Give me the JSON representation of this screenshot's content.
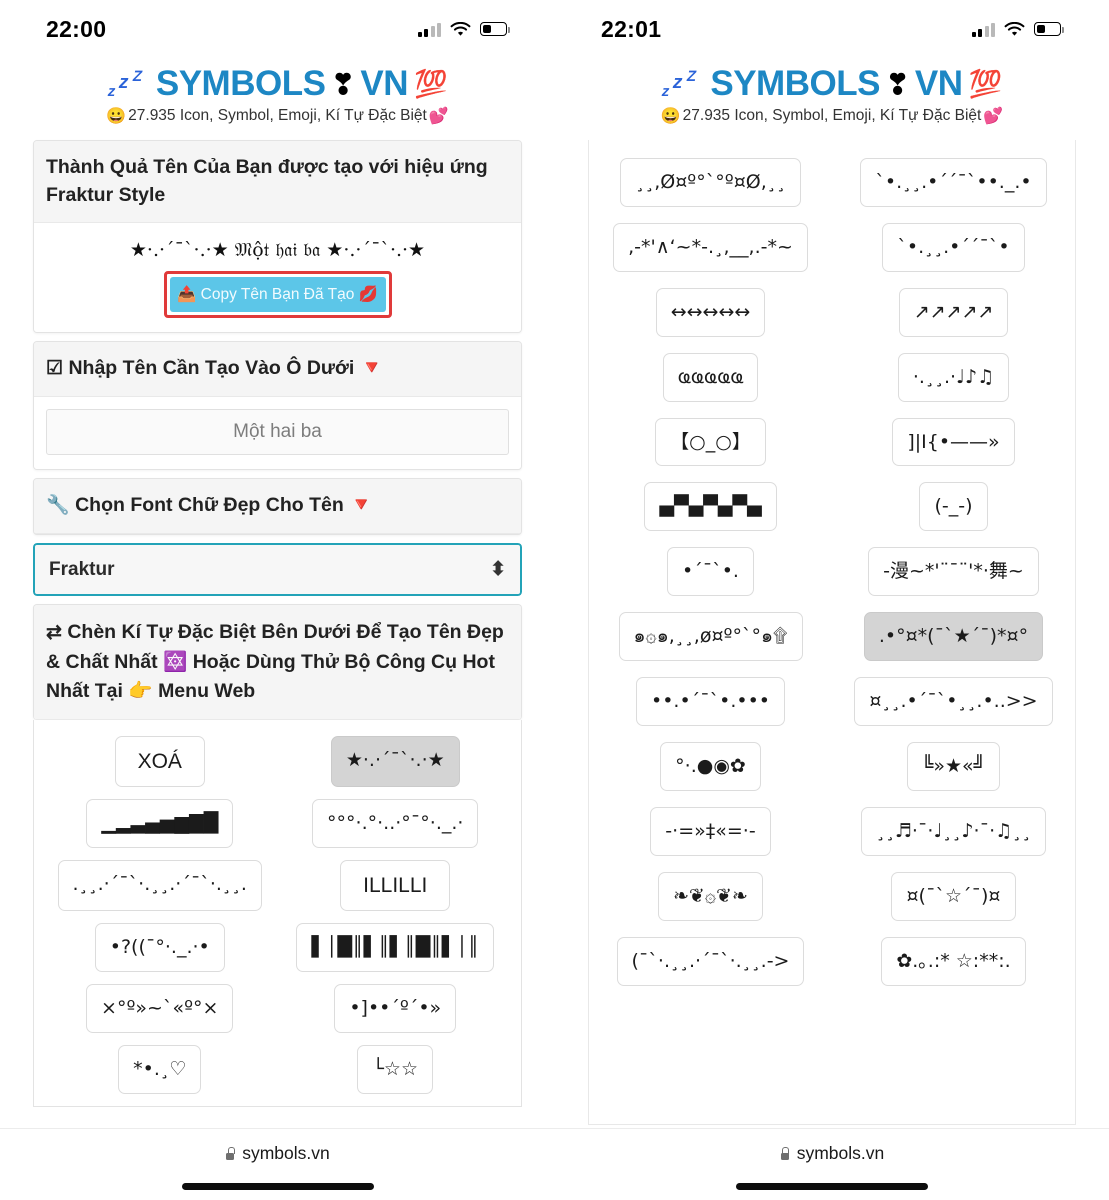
{
  "left": {
    "status": {
      "time": "22:00"
    },
    "logo": {
      "zzz": [
        "z",
        "z",
        "Z"
      ],
      "brand": "SYMBOLS",
      "heart": "❣",
      "vn": "VN",
      "hundred": "💯",
      "tagline_emoji_left": "😀",
      "tagline": "27.935 Icon, Symbol, Emoji, Kí Tự Đặc Biệt",
      "tagline_emoji_right": "💕"
    },
    "result_card": {
      "heading": "Thành Quả Tên Của Bạn được tạo với hiệu ứng Fraktur Style",
      "result_text": "★·.·´¯`·.·★ 𝔐ộ𝔱 𝔥𝔞𝔦 𝔟𝔞 ★·.·´¯`·.·★",
      "copy_label": "📤 Copy Tên Bạn Đã Tạo 💋",
      "highlight_color": "#e03a3a",
      "button_color": "#5cc6e8"
    },
    "input_card": {
      "heading_icon": "☑",
      "heading": "Nhập Tên Cần Tạo Vào Ô Dưới",
      "heading_marker": "🔻",
      "value": "Một hai ba",
      "placeholder": "Một hai ba"
    },
    "font_card": {
      "heading_icon": "🔧",
      "heading": "Chọn Font Chữ Đẹp Cho Tên",
      "heading_marker": "🔻",
      "selected": "Fraktur",
      "chevron": "⬍",
      "accent_color": "#23a3b8"
    },
    "note_card": {
      "icon": "⇄",
      "text_1": "Chèn Kí Tự Đặc Biệt Bên Dưới Để Tạo Tên Đẹp & Chất Nhất",
      "emoji": "🔯",
      "text_2": "Hoặc Dùng Thử Bộ Công Cụ Hot Nhất Tại",
      "emoji_2": "👉",
      "text_3": "Menu Web"
    },
    "symbols": [
      {
        "text": "XOÁ",
        "selected": false,
        "plain": true
      },
      {
        "text": "★·.·´¯`·.·★",
        "selected": true,
        "plain": false
      },
      {
        "text": "▁▂▃▄▅▆▇█",
        "selected": false,
        "plain": false
      },
      {
        "text": "°°°·.°·..·°¯°·._.·",
        "selected": false,
        "plain": false
      },
      {
        "text": ".¸¸.·´¯`·.¸¸.·´¯`·.¸¸.",
        "selected": false,
        "plain": false
      },
      {
        "text": "ILLILLI",
        "selected": false,
        "plain": true
      },
      {
        "text": "•?((¯°·._.·•",
        "selected": false,
        "plain": false
      },
      {
        "text": "▌│█║▌║▌║█║▌│║",
        "selected": false,
        "plain": false
      },
      {
        "text": "×°º»~`«º°×",
        "selected": false,
        "plain": false
      },
      {
        "text": "•]••´º´•»",
        "selected": false,
        "plain": false
      },
      {
        "text": "*•.¸♡",
        "selected": false,
        "plain": false
      },
      {
        "text": "└☆☆",
        "selected": false,
        "plain": false
      }
    ],
    "bottom": {
      "url": "symbols.vn",
      "lock": "lock-icon"
    }
  },
  "right": {
    "status": {
      "time": "22:01"
    },
    "logo": {
      "zzz": [
        "z",
        "z",
        "Z"
      ],
      "brand": "SYMBOLS",
      "heart": "❣",
      "vn": "VN",
      "hundred": "💯",
      "tagline_emoji_left": "😀",
      "tagline": "27.935 Icon, Symbol, Emoji, Kí Tự Đặc Biệt",
      "tagline_emoji_right": "💕"
    },
    "symbols": [
      {
        "text": "¸¸,Ø¤º°`°º¤Ø,¸¸",
        "selected": false
      },
      {
        "text": "`•.¸¸.•´´¯`••._.•",
        "selected": false
      },
      {
        "text": ",-*'∧‘~*-.¸,__,.-*~",
        "selected": false
      },
      {
        "text": "`•.¸¸.•´´¯`•",
        "selected": false
      },
      {
        "text": "↔↔↔↔↔",
        "selected": false
      },
      {
        "text": "↗↗↗↗↗",
        "selected": false
      },
      {
        "text": "ҩҩҩҩҩ",
        "selected": false
      },
      {
        "text": "·.¸¸.·♩♪♫",
        "selected": false
      },
      {
        "text": "【○_○】",
        "selected": false
      },
      {
        "text": "]|I{•——»",
        "selected": false
      },
      {
        "text": "▄▀▄▀▄▀▄",
        "selected": false
      },
      {
        "text": "(-_-)",
        "selected": false
      },
      {
        "text": "•´¯`•.",
        "selected": false
      },
      {
        "text": "-漫~*'¨¯¨'*·舞~",
        "selected": false
      },
      {
        "text": "๑۞๑,¸¸,ø¤º°`°๑۩",
        "selected": false
      },
      {
        "text": ".•°¤*(¯`★´¯)*¤°",
        "selected": true
      },
      {
        "text": "••.•´¯`•.•••",
        "selected": false
      },
      {
        "text": "¤¸¸.•´¯`•¸¸.•..>>",
        "selected": false
      },
      {
        "text": "°·.●◉✿",
        "selected": false
      },
      {
        "text": "╚»★«╝",
        "selected": false
      },
      {
        "text": "-·=»‡«=·-",
        "selected": false
      },
      {
        "text": "¸¸♬·¯·♩¸¸♪·¯·♫¸¸",
        "selected": false
      },
      {
        "text": "❧❦۞❦❧",
        "selected": false
      },
      {
        "text": "¤(¯`☆´¯)¤",
        "selected": false
      },
      {
        "text": "(¯`·.¸¸.·´¯`·.¸¸.->",
        "selected": false
      },
      {
        "text": "✿.｡.:* ☆:**:.",
        "selected": false
      }
    ],
    "bottom": {
      "url": "symbols.vn",
      "lock": "lock-icon"
    }
  }
}
